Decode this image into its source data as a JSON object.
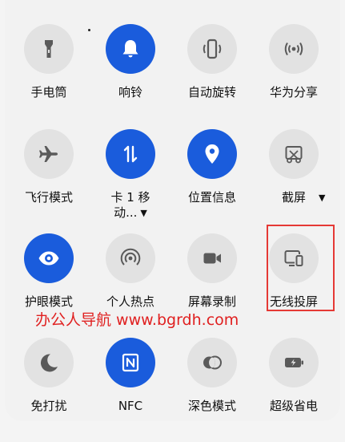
{
  "tiles": [
    {
      "label": "手电筒",
      "icon": "flashlight-icon",
      "active": false
    },
    {
      "label": "响铃",
      "icon": "bell-icon",
      "active": true
    },
    {
      "label": "自动旋转",
      "icon": "auto-rotate-icon",
      "active": false
    },
    {
      "label": "华为分享",
      "icon": "huawei-share-icon",
      "active": false
    },
    {
      "label": "飞行模式",
      "icon": "airplane-icon",
      "active": false
    },
    {
      "label": "卡 1 移动...",
      "icon": "mobile-data-icon",
      "active": true
    },
    {
      "label": "位置信息",
      "icon": "location-pin-icon",
      "active": true
    },
    {
      "label": "截屏",
      "icon": "screenshot-icon",
      "active": false
    },
    {
      "label": "护眼模式",
      "icon": "eye-icon",
      "active": true
    },
    {
      "label": "个人热点",
      "icon": "hotspot-icon",
      "active": false
    },
    {
      "label": "屏幕录制",
      "icon": "video-camera-icon",
      "active": false
    },
    {
      "label": "无线投屏",
      "icon": "wireless-projection-icon",
      "active": false
    },
    {
      "label": "免打扰",
      "icon": "moon-icon",
      "active": false
    },
    {
      "label": "NFC",
      "icon": "nfc-icon",
      "active": true
    },
    {
      "label": "深色模式",
      "icon": "dark-mode-icon",
      "active": false
    },
    {
      "label": "超级省电",
      "icon": "battery-saver-icon",
      "active": false
    }
  ],
  "watermark": "办公人导航 www.bgrdh.com",
  "colors": {
    "accent": "#1a5cdc",
    "inactive": "#e2e2e2",
    "icon_inactive": "#5a5a5a",
    "highlight": "#e53935",
    "watermark": "#e02020"
  }
}
